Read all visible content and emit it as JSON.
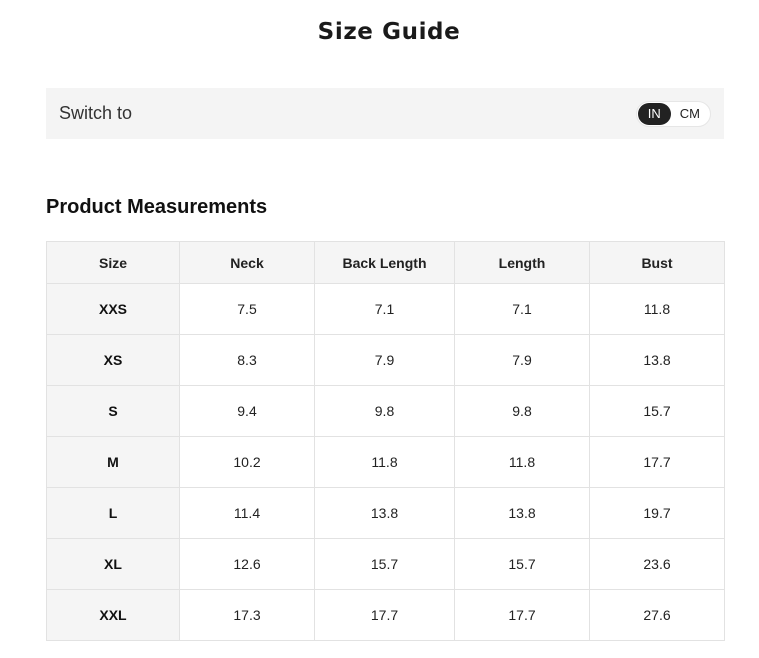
{
  "page": {
    "title": "Size Guide"
  },
  "unit_switch": {
    "label": "Switch to",
    "options": [
      "IN",
      "CM"
    ],
    "selected": "IN"
  },
  "section": {
    "title": "Product Measurements"
  },
  "table": {
    "headers": [
      "Size",
      "Neck",
      "Back Length",
      "Length",
      "Bust"
    ],
    "rows": [
      [
        "XXS",
        "7.5",
        "7.1",
        "7.1",
        "11.8"
      ],
      [
        "XS",
        "8.3",
        "7.9",
        "7.9",
        "13.8"
      ],
      [
        "S",
        "9.4",
        "9.8",
        "9.8",
        "15.7"
      ],
      [
        "M",
        "10.2",
        "11.8",
        "11.8",
        "17.7"
      ],
      [
        "L",
        "11.4",
        "13.8",
        "13.8",
        "19.7"
      ],
      [
        "XL",
        "12.6",
        "15.7",
        "15.7",
        "23.6"
      ],
      [
        "XXL",
        "17.3",
        "17.7",
        "17.7",
        "27.6"
      ]
    ]
  }
}
